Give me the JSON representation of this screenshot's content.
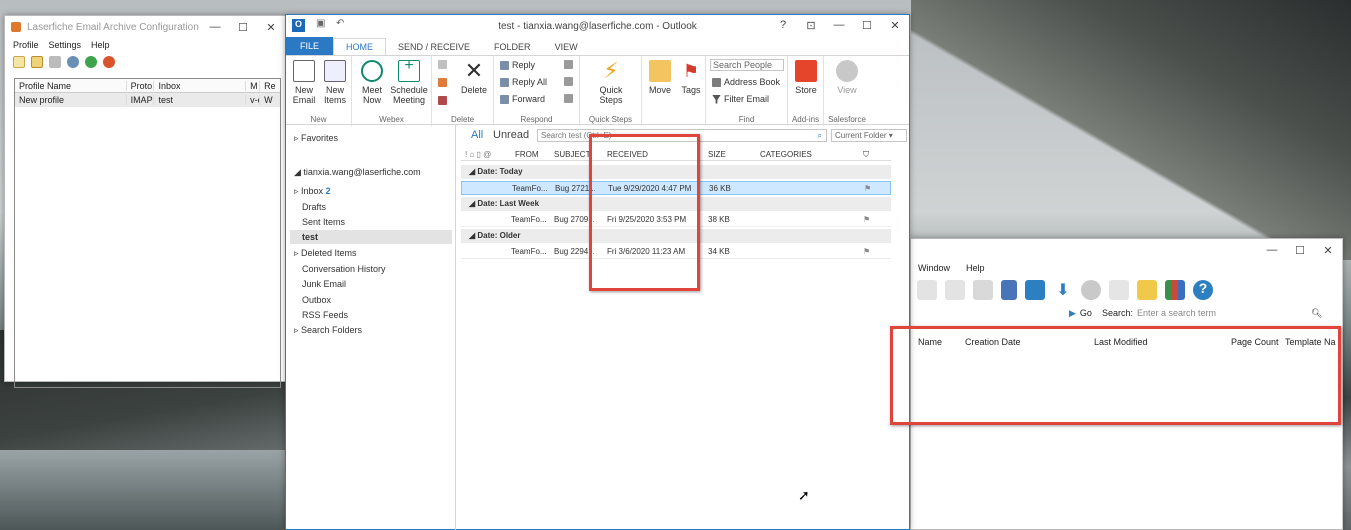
{
  "archive": {
    "title": "Laserfiche Email Archive Configuration",
    "menu": [
      "Profile",
      "Settings",
      "Help"
    ],
    "columns": [
      "Profile Name",
      "Proto",
      "Inbox",
      "M",
      "Re"
    ],
    "row": {
      "name": "New profile",
      "proto": "IMAP",
      "inbox": "test",
      "m": "v-e›",
      "re": "W"
    }
  },
  "outlook": {
    "title": "test - tianxia.wang@laserfiche.com - Outlook",
    "tabs": [
      "FILE",
      "HOME",
      "SEND / RECEIVE",
      "FOLDER",
      "VIEW"
    ],
    "ribbon": {
      "new_email": "New\nEmail",
      "new_items": "New\nItems",
      "meet_now": "Meet\nNow",
      "schedule_meeting": "Schedule\nMeeting",
      "delete": "Delete",
      "reply": "Reply",
      "reply_all": "Reply All",
      "forward": "Forward",
      "quick_steps": "Quick\nSteps",
      "move": "Move",
      "tags": "Tags",
      "search_people": "Search People",
      "address_book": "Address Book",
      "filter_email": "Filter Email",
      "store": "Store",
      "view": "View",
      "groups": [
        "New",
        "Webex",
        "Delete",
        "Respond",
        "Quick Steps",
        "Find",
        "Add-ins",
        "Salesforce"
      ]
    },
    "nav": {
      "favorites": "Favorites",
      "account": "tianxia.wang@laserfiche.com",
      "inbox": "Inbox",
      "inbox_count": "2",
      "folders": [
        "Drafts",
        "Sent Items",
        "test",
        "Deleted Items",
        "Conversation History",
        "Junk Email",
        "Outbox",
        "RSS Feeds",
        "Search Folders"
      ]
    },
    "filters": {
      "all": "All",
      "unread": "Unread",
      "search_placeholder": "Search test (Ctrl+E)",
      "scope": "Current Folder"
    },
    "columns": [
      "FROM",
      "SUBJECT",
      "RECEIVED",
      "SIZE",
      "CATEGORIES"
    ],
    "groups": [
      {
        "label": "Date: Today",
        "from": "TeamFo...",
        "subject": "Bug 2721...",
        "received": "Tue 9/29/2020 4:47 PM",
        "size": "36 KB"
      },
      {
        "label": "Date: Last Week",
        "from": "TeamFo...",
        "subject": "Bug 2709...",
        "received": "Fri 9/25/2020 3:53 PM",
        "size": "38 KB"
      },
      {
        "label": "Date: Older",
        "from": "TeamFo...",
        "subject": "Bug 2294...",
        "received": "Fri 3/6/2020 11:23 AM",
        "size": "34 KB"
      }
    ]
  },
  "repo": {
    "menu": [
      "Window",
      "Help"
    ],
    "go": "Go",
    "search_label": "Search:",
    "search_placeholder": "Enter a search term",
    "columns": [
      "Name",
      "Creation Date",
      "Last Modified",
      "Page Count",
      "Template Na"
    ]
  }
}
